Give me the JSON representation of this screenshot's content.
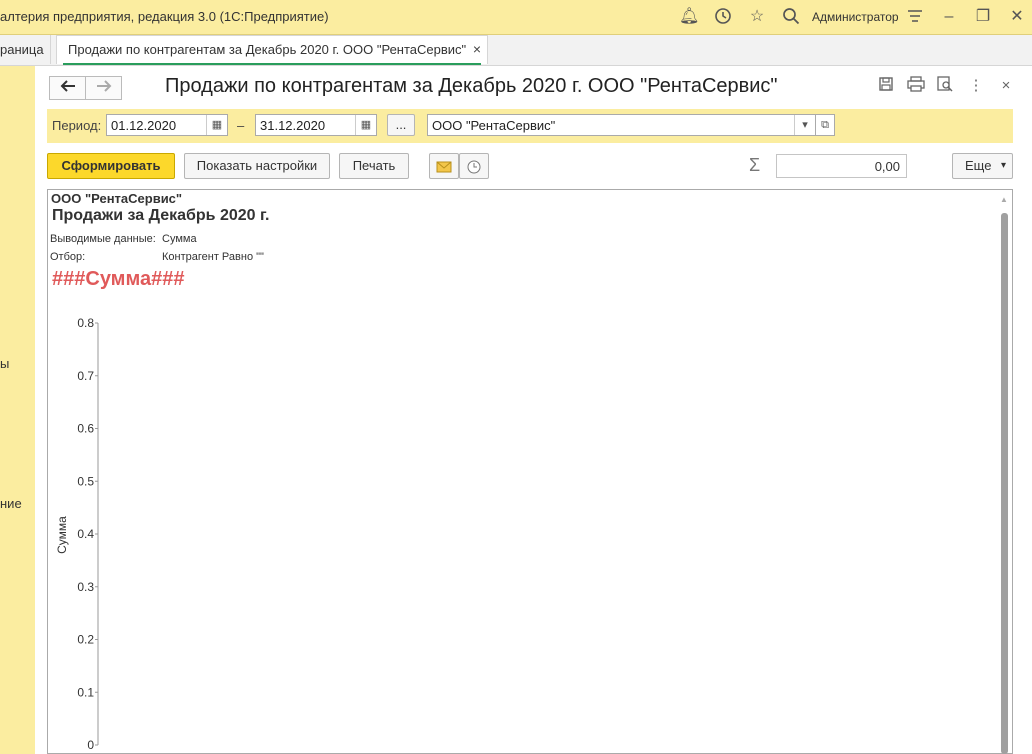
{
  "titlebar": {
    "app_title": "алтерия предприятия, редакция 3.0  (1С:Предприятие)",
    "user": "Администратор",
    "icons": [
      "bell-icon",
      "history-icon",
      "star-icon",
      "search-icon",
      "menu-icon",
      "minimize-icon",
      "restore-icon",
      "close-icon"
    ]
  },
  "tabs": {
    "home_label": "раница",
    "active_label": "Продажи по контрагентам за Декабрь 2020 г. ООО \"РентаСервис\"",
    "close_glyph": "×"
  },
  "sidebar": {
    "items": [
      "ы",
      "ние"
    ]
  },
  "form": {
    "title": "Продажи по контрагентам за Декабрь 2020 г. ООО \"РентаСервис\"",
    "back_glyph": "🡐",
    "forward_glyph": "🡒"
  },
  "params": {
    "period_label": "Период:",
    "date_from": "01.12.2020",
    "dash": "–",
    "date_to": "31.12.2020",
    "dots": "...",
    "org_value": "ООО \"РентаСервис\""
  },
  "commands": {
    "generate": "Сформировать",
    "show_settings": "Показать настройки",
    "print": "Печать",
    "sum_value": "0,00",
    "more": "Еще"
  },
  "report": {
    "org": "ООО \"РентаСервис\"",
    "title": "Продажи за Декабрь 2020 г.",
    "output_label": "Выводимые данные:",
    "output_value": "Сумма",
    "filter_label": "Отбор:",
    "filter_value": "Контрагент Равно \"\"",
    "placeholder": "###Сумма###"
  },
  "chart_data": {
    "type": "bar",
    "categories": [],
    "values": [],
    "title": "",
    "xlabel": "",
    "ylabel": "Сумма",
    "ylim": [
      0,
      0.8
    ],
    "yticks": [
      "0",
      "0.1",
      "0.2",
      "0.3",
      "0.4",
      "0.5",
      "0.6",
      "0.7",
      "0.8"
    ]
  }
}
